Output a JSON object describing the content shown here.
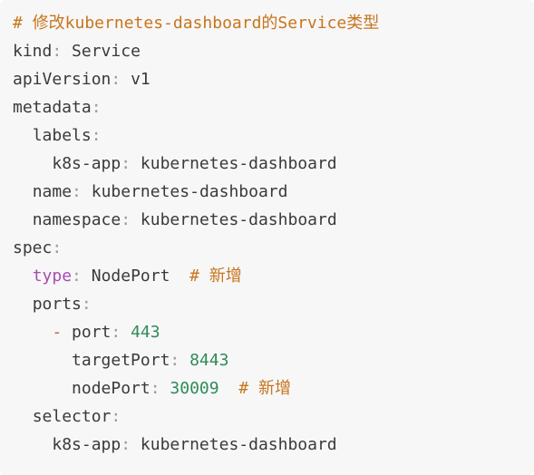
{
  "code": {
    "header_comment": "# 修改kubernetes-dashboard的Service类型",
    "kind_key": "kind",
    "kind_value": "Service",
    "apiversion_key": "apiVersion",
    "apiversion_value": "v1",
    "metadata_key": "metadata",
    "labels_key": "labels",
    "k8s_app_key": "k8s-app",
    "k8s_app_value": "kubernetes-dashboard",
    "name_key": "name",
    "name_value": "kubernetes-dashboard",
    "namespace_key": "namespace",
    "namespace_value": "kubernetes-dashboard",
    "spec_key": "spec",
    "type_key": "type",
    "type_value": "NodePort",
    "type_comment": "# 新增",
    "ports_key": "ports",
    "dash": "-",
    "port_key": "port",
    "port_value": "443",
    "targetport_key": "targetPort",
    "targetport_value": "8443",
    "nodeport_key": "nodePort",
    "nodeport_value": "30009",
    "nodeport_comment": "# 新增",
    "selector_key": "selector",
    "selector_app_key": "k8s-app",
    "selector_app_value": "kubernetes-dashboard"
  },
  "colors": {
    "comment": "#c8751c",
    "accent_key": "#a84bb0",
    "number": "#2e8b57",
    "dash": "#d9534f",
    "background": "#f7f7f8"
  }
}
